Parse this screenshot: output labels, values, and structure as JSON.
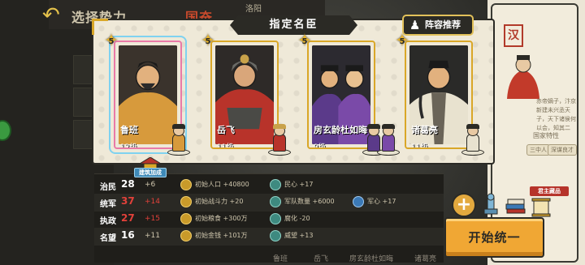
{
  "background": {
    "tabs": [
      "选择势力",
      "国奋"
    ],
    "sub_label": "洛阳",
    "seal_char": "汉",
    "right_text": "赤帝嫡子，汴京新建未兴丞天子，天下诸侯何以会，知其二",
    "right_attr_label": "国家特性",
    "right_tags": [
      "三中人",
      "深谋良才"
    ]
  },
  "modal": {
    "title": "指定名臣",
    "recommend_label": "阵容推荐"
  },
  "heroes": [
    {
      "name": "鲁班",
      "level": "12级",
      "stars": "5"
    },
    {
      "name": "岳飞",
      "level": "11级",
      "stars": "5"
    },
    {
      "name": "房玄龄杜如晦",
      "level": "9级",
      "stars": "5"
    },
    {
      "name": "诸葛亮",
      "level": "11级",
      "stars": "5"
    }
  ],
  "build_badge": "建筑加成",
  "stats": [
    {
      "name": "治民",
      "value": "28",
      "plus": "+6",
      "effects": [
        {
          "icon": "gold-coin",
          "text": "初始人口 +40800"
        },
        {
          "icon": "teal-heart",
          "text": "民心 +17"
        }
      ]
    },
    {
      "name": "统军",
      "value": "37",
      "plus": "+14",
      "effects": [
        {
          "icon": "gold-sword",
          "text": "初始战斗力 +20"
        },
        {
          "icon": "teal-army",
          "text": "军队数量 +6000"
        },
        {
          "icon": "blue-loyalty",
          "text": "军心 +17"
        }
      ]
    },
    {
      "name": "执政",
      "value": "27",
      "plus": "+15",
      "effects": [
        {
          "icon": "gold-grain",
          "text": "初始粮食 +300万"
        },
        {
          "icon": "teal-corruption",
          "text": "腐化 -20"
        }
      ]
    },
    {
      "name": "名望",
      "value": "16",
      "plus": "+11",
      "effects": [
        {
          "icon": "gold-money",
          "text": "初始金钱 +101万"
        },
        {
          "icon": "teal-prestige",
          "text": "威望 +13"
        }
      ]
    }
  ],
  "roster_names": [
    "鲁班",
    "岳飞",
    "房玄龄杜如晦",
    "诸葛亮"
  ],
  "lord_badge": "君主藏品",
  "start_button": "开始统一",
  "colors": {
    "accent": "#f0a734",
    "panel": "#2b2a25",
    "stat_red": "#e2413a",
    "frame_gold": "#d9a728"
  }
}
